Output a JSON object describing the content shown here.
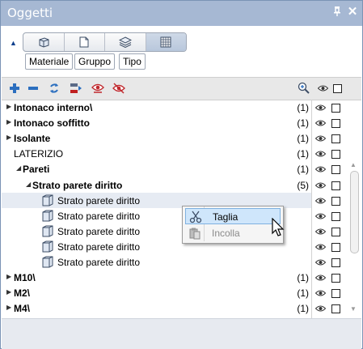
{
  "window": {
    "title": "Oggetti",
    "pin_icon": "pin-icon",
    "close_icon": "close-icon"
  },
  "view_buttons": [
    {
      "name": "view-3d-objects-button",
      "icon": "cube-icon"
    },
    {
      "name": "view-document-button",
      "icon": "page-icon"
    },
    {
      "name": "view-layers-button",
      "icon": "layers-icon"
    },
    {
      "name": "view-grid-button",
      "icon": "grid-icon",
      "active": true
    }
  ],
  "group_buttons": {
    "material": "Materiale",
    "group": "Gruppo",
    "type": "Tipo"
  },
  "toolbar_icons": [
    "expand-all-icon",
    "collapse-all-icon",
    "refresh-icon",
    "move-icon",
    "show-all-icon",
    "hide-all-icon",
    "zoom-icon"
  ],
  "tree": {
    "rows": [
      {
        "label": "Intonaco interno\\",
        "count": "(1)",
        "level": 0,
        "bold": true,
        "expander": "collapsed"
      },
      {
        "label": "Intonaco soffitto",
        "count": "(1)",
        "level": 0,
        "bold": true,
        "expander": "collapsed"
      },
      {
        "label": "Isolante",
        "count": "(1)",
        "level": 0,
        "bold": true,
        "expander": "collapsed"
      },
      {
        "label": "LATERIZIO",
        "count": "(1)",
        "level": 0,
        "bold": false,
        "expander": "none"
      },
      {
        "label": "Pareti",
        "count": "(1)",
        "level": 1,
        "bold": true,
        "expander": "expanded"
      },
      {
        "label": "Strato parete diritto",
        "count": "(5)",
        "level": 2,
        "bold": true,
        "expander": "expanded"
      },
      {
        "label": "Strato parete diritto",
        "count": "",
        "level": 3,
        "bold": false,
        "expander": "leaf",
        "selected": true
      },
      {
        "label": "Strato parete diritto",
        "count": "",
        "level": 3,
        "bold": false,
        "expander": "leaf"
      },
      {
        "label": "Strato parete diritto",
        "count": "",
        "level": 3,
        "bold": false,
        "expander": "leaf"
      },
      {
        "label": "Strato parete diritto",
        "count": "",
        "level": 3,
        "bold": false,
        "expander": "leaf"
      },
      {
        "label": "Strato parete diritto",
        "count": "",
        "level": 3,
        "bold": false,
        "expander": "leaf"
      },
      {
        "label": "M10\\",
        "count": "(1)",
        "level": 0,
        "bold": true,
        "expander": "collapsed"
      },
      {
        "label": "M2\\",
        "count": "(1)",
        "level": 0,
        "bold": true,
        "expander": "collapsed"
      },
      {
        "label": "M4\\",
        "count": "(1)",
        "level": 0,
        "bold": true,
        "expander": "collapsed"
      }
    ]
  },
  "context_menu": {
    "cut": "Taglia",
    "paste": "Incolla"
  }
}
